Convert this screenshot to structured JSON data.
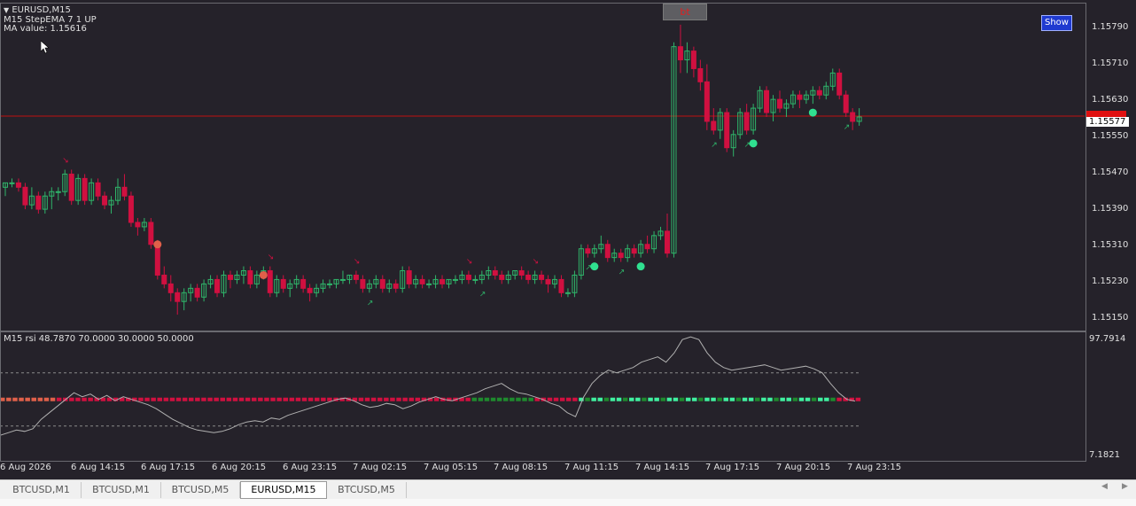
{
  "chart": {
    "symbol_header": "EURUSD,M15",
    "indicator_line": "M15 StepEMA 7 1 UP",
    "ma_value": "MA value: 1.15616",
    "show_button": "Show",
    "bt_button": "bt",
    "price_axis": [
      "1.15790",
      "1.15710",
      "1.15630",
      "1.15550",
      "1.15470",
      "1.15390",
      "1.15310",
      "1.15230",
      "1.15150"
    ],
    "current_price": "1.15577",
    "current_price_hidden": "1.15592",
    "time_axis": [
      "6 Aug 2026",
      "6 Aug 14:15",
      "6 Aug 17:15",
      "6 Aug 20:15",
      "6 Aug 23:15",
      "7 Aug 02:15",
      "7 Aug 05:15",
      "7 Aug 08:15",
      "7 Aug 11:15",
      "7 Aug 14:15",
      "7 Aug 17:15",
      "7 Aug 20:15",
      "7 Aug 23:15"
    ]
  },
  "rsi": {
    "label": "M15 rsi  48.7870 70.0000 30.0000 50.0000",
    "axis_top": "97.7914",
    "axis_bottom": "7.1821"
  },
  "tabs": [
    {
      "label": "BTCUSD,M1",
      "active": false
    },
    {
      "label": "BTCUSD,M1",
      "active": false
    },
    {
      "label": "BTCUSD,M5",
      "active": false
    },
    {
      "label": "EURUSD,M15",
      "active": true
    },
    {
      "label": "BTCUSD,M5",
      "active": false
    }
  ],
  "colors": {
    "background": "#25222a",
    "bull": "#2fb56a",
    "bear": "#d01040",
    "current_price_line": "#c01010",
    "rsi_line": "#b0b0b0"
  },
  "chart_data": {
    "type": "candlestick",
    "symbol": "EURUSD",
    "timeframe": "M15",
    "ylim": [
      1.1512,
      1.1583
    ],
    "candles": [
      [
        1.1543,
        1.1544,
        1.1541,
        1.1544
      ],
      [
        1.1544,
        1.1545,
        1.1543,
        1.1544
      ],
      [
        1.1544,
        1.1545,
        1.1542,
        1.1543
      ],
      [
        1.1543,
        1.1544,
        1.1538,
        1.1539
      ],
      [
        1.1539,
        1.1543,
        1.1538,
        1.1541
      ],
      [
        1.1541,
        1.1542,
        1.1537,
        1.1538
      ],
      [
        1.1538,
        1.1542,
        1.1537,
        1.1541
      ],
      [
        1.1541,
        1.1543,
        1.1538,
        1.1542
      ],
      [
        1.1542,
        1.1543,
        1.154,
        1.1542
      ],
      [
        1.1542,
        1.1547,
        1.1541,
        1.1546
      ],
      [
        1.1546,
        1.1547,
        1.1539,
        1.154
      ],
      [
        1.154,
        1.1546,
        1.1539,
        1.1545
      ],
      [
        1.1545,
        1.1546,
        1.1539,
        1.154
      ],
      [
        1.154,
        1.1545,
        1.1539,
        1.1544
      ],
      [
        1.1544,
        1.1545,
        1.154,
        1.1541
      ],
      [
        1.1541,
        1.1542,
        1.1538,
        1.1539
      ],
      [
        1.1539,
        1.1541,
        1.1537,
        1.154
      ],
      [
        1.154,
        1.1545,
        1.1539,
        1.1543
      ],
      [
        1.1543,
        1.1546,
        1.154,
        1.1541
      ],
      [
        1.1541,
        1.1542,
        1.1534,
        1.1535
      ],
      [
        1.1535,
        1.1536,
        1.1532,
        1.1534
      ],
      [
        1.1534,
        1.1536,
        1.1533,
        1.1535
      ],
      [
        1.1535,
        1.1536,
        1.1529,
        1.153
      ],
      [
        1.153,
        1.1531,
        1.1522,
        1.1523
      ],
      [
        1.1523,
        1.1525,
        1.152,
        1.1521
      ],
      [
        1.1521,
        1.1523,
        1.1517,
        1.1519
      ],
      [
        1.1519,
        1.152,
        1.1514,
        1.1517
      ],
      [
        1.1517,
        1.152,
        1.1515,
        1.1519
      ],
      [
        1.1519,
        1.1521,
        1.1517,
        1.152
      ],
      [
        1.152,
        1.1521,
        1.1517,
        1.1518
      ],
      [
        1.1518,
        1.1522,
        1.1517,
        1.1521
      ],
      [
        1.1521,
        1.1523,
        1.152,
        1.1522
      ],
      [
        1.1522,
        1.1523,
        1.1518,
        1.1519
      ],
      [
        1.1519,
        1.1524,
        1.1518,
        1.1523
      ],
      [
        1.1523,
        1.1524,
        1.152,
        1.1522
      ],
      [
        1.1522,
        1.1524,
        1.1521,
        1.1523
      ],
      [
        1.1523,
        1.1525,
        1.1521,
        1.1524
      ],
      [
        1.1524,
        1.1525,
        1.152,
        1.1521
      ],
      [
        1.1521,
        1.1524,
        1.152,
        1.1523
      ],
      [
        1.1523,
        1.1525,
        1.1522,
        1.1524
      ],
      [
        1.1524,
        1.1525,
        1.1518,
        1.1519
      ],
      [
        1.1519,
        1.1523,
        1.1518,
        1.1522
      ],
      [
        1.1522,
        1.1523,
        1.1519,
        1.152
      ],
      [
        1.152,
        1.1522,
        1.1518,
        1.1521
      ],
      [
        1.1521,
        1.1523,
        1.152,
        1.1522
      ],
      [
        1.1522,
        1.1523,
        1.1519,
        1.152
      ],
      [
        1.152,
        1.1521,
        1.1517,
        1.1519
      ],
      [
        1.1519,
        1.1521,
        1.1518,
        1.152
      ],
      [
        1.152,
        1.1522,
        1.1519,
        1.1521
      ],
      [
        1.1521,
        1.1522,
        1.152,
        1.1521
      ],
      [
        1.1521,
        1.1522,
        1.152,
        1.1522
      ],
      [
        1.1522,
        1.1524,
        1.1521,
        1.1522
      ],
      [
        1.1522,
        1.1523,
        1.1521,
        1.1523
      ],
      [
        1.1523,
        1.1524,
        1.1521,
        1.1522
      ],
      [
        1.1522,
        1.1523,
        1.1519,
        1.152
      ],
      [
        1.152,
        1.1522,
        1.1519,
        1.1521
      ],
      [
        1.1521,
        1.1523,
        1.152,
        1.1522
      ],
      [
        1.1522,
        1.1523,
        1.1519,
        1.152
      ],
      [
        1.152,
        1.1522,
        1.1519,
        1.1521
      ],
      [
        1.1521,
        1.1522,
        1.1519,
        1.152
      ],
      [
        1.152,
        1.1525,
        1.1519,
        1.1524
      ],
      [
        1.1524,
        1.1525,
        1.152,
        1.1521
      ],
      [
        1.1521,
        1.1523,
        1.152,
        1.1522
      ],
      [
        1.1522,
        1.1523,
        1.152,
        1.1521
      ],
      [
        1.1521,
        1.1522,
        1.152,
        1.1521
      ],
      [
        1.1521,
        1.1523,
        1.152,
        1.1522
      ],
      [
        1.1522,
        1.1523,
        1.152,
        1.1521
      ],
      [
        1.1521,
        1.1522,
        1.152,
        1.1522
      ],
      [
        1.1522,
        1.1523,
        1.1521,
        1.1522
      ],
      [
        1.1522,
        1.1524,
        1.1521,
        1.1523
      ],
      [
        1.1523,
        1.1524,
        1.1521,
        1.1522
      ],
      [
        1.1522,
        1.1523,
        1.1521,
        1.1522
      ],
      [
        1.1522,
        1.1524,
        1.1521,
        1.1523
      ],
      [
        1.1523,
        1.1525,
        1.1522,
        1.1524
      ],
      [
        1.1524,
        1.1525,
        1.1522,
        1.1523
      ],
      [
        1.1523,
        1.1524,
        1.1521,
        1.1522
      ],
      [
        1.1522,
        1.1524,
        1.1521,
        1.1523
      ],
      [
        1.1523,
        1.1524,
        1.1522,
        1.1524
      ],
      [
        1.1524,
        1.1525,
        1.1522,
        1.1523
      ],
      [
        1.1523,
        1.1524,
        1.1521,
        1.1522
      ],
      [
        1.1522,
        1.1524,
        1.1521,
        1.1523
      ],
      [
        1.1523,
        1.1524,
        1.1521,
        1.1522
      ],
      [
        1.1522,
        1.1523,
        1.1519,
        1.1521
      ],
      [
        1.1521,
        1.1523,
        1.152,
        1.1522
      ],
      [
        1.1522,
        1.1523,
        1.1518,
        1.1519
      ],
      [
        1.1519,
        1.152,
        1.1518,
        1.1519
      ],
      [
        1.1519,
        1.1524,
        1.1518,
        1.1523
      ],
      [
        1.1523,
        1.153,
        1.1522,
        1.1529
      ],
      [
        1.1529,
        1.153,
        1.1527,
        1.1528
      ],
      [
        1.1528,
        1.153,
        1.1527,
        1.1529
      ],
      [
        1.1529,
        1.1532,
        1.1528,
        1.153
      ],
      [
        1.153,
        1.1531,
        1.1526,
        1.1527
      ],
      [
        1.1527,
        1.1529,
        1.1526,
        1.1528
      ],
      [
        1.1528,
        1.1529,
        1.1526,
        1.1527
      ],
      [
        1.1527,
        1.153,
        1.1526,
        1.1529
      ],
      [
        1.1529,
        1.153,
        1.1527,
        1.1528
      ],
      [
        1.1528,
        1.1531,
        1.1527,
        1.153
      ],
      [
        1.153,
        1.1532,
        1.1528,
        1.1529
      ],
      [
        1.1529,
        1.1533,
        1.1528,
        1.1532
      ],
      [
        1.1532,
        1.1534,
        1.1531,
        1.1533
      ],
      [
        1.1533,
        1.1537,
        1.1527,
        1.1528
      ],
      [
        1.1528,
        1.1576,
        1.1527,
        1.1575
      ],
      [
        1.1575,
        1.158,
        1.1569,
        1.1572
      ],
      [
        1.1572,
        1.1576,
        1.1569,
        1.1574
      ],
      [
        1.1574,
        1.1575,
        1.1568,
        1.157
      ],
      [
        1.157,
        1.1572,
        1.1565,
        1.1567
      ],
      [
        1.1567,
        1.1571,
        1.1556,
        1.1558
      ],
      [
        1.1558,
        1.1561,
        1.1555,
        1.1556
      ],
      [
        1.1556,
        1.1561,
        1.1554,
        1.156
      ],
      [
        1.156,
        1.1561,
        1.1551,
        1.1552
      ],
      [
        1.1552,
        1.1556,
        1.155,
        1.1555
      ],
      [
        1.1555,
        1.1561,
        1.1554,
        1.156
      ],
      [
        1.156,
        1.1562,
        1.1555,
        1.1556
      ],
      [
        1.1556,
        1.1562,
        1.1555,
        1.1561
      ],
      [
        1.1561,
        1.1566,
        1.156,
        1.1565
      ],
      [
        1.1565,
        1.1566,
        1.1559,
        1.156
      ],
      [
        1.156,
        1.1564,
        1.1558,
        1.1563
      ],
      [
        1.1563,
        1.1565,
        1.156,
        1.1561
      ],
      [
        1.1561,
        1.1563,
        1.1559,
        1.1562
      ],
      [
        1.1562,
        1.1565,
        1.1561,
        1.1564
      ],
      [
        1.1564,
        1.1565,
        1.1561,
        1.1563
      ],
      [
        1.1563,
        1.1565,
        1.1562,
        1.1564
      ],
      [
        1.1564,
        1.1566,
        1.1562,
        1.1565
      ],
      [
        1.1565,
        1.1566,
        1.1563,
        1.1564
      ],
      [
        1.1564,
        1.1567,
        1.1563,
        1.1566
      ],
      [
        1.1566,
        1.157,
        1.1565,
        1.1569
      ],
      [
        1.1569,
        1.157,
        1.1563,
        1.1564
      ],
      [
        1.1564,
        1.1565,
        1.1559,
        1.156
      ],
      [
        1.156,
        1.1561,
        1.1556,
        1.1558
      ],
      [
        1.1558,
        1.1561,
        1.1557,
        1.1559
      ]
    ],
    "rsi_ylim": [
      7.1821,
      97.7914
    ],
    "rsi_levels": [
      70,
      50,
      30
    ],
    "rsi_values": [
      23,
      25,
      27,
      26,
      28,
      35,
      40,
      45,
      50,
      55,
      52,
      54,
      50,
      53,
      49,
      52,
      50,
      48,
      46,
      43,
      39,
      35,
      32,
      29,
      27,
      26,
      25,
      26,
      28,
      31,
      33,
      34,
      33,
      36,
      35,
      38,
      40,
      42,
      44,
      46,
      48,
      50,
      51,
      49,
      46,
      44,
      45,
      47,
      46,
      43,
      45,
      48,
      50,
      52,
      50,
      49,
      51,
      53,
      55,
      58,
      60,
      62,
      58,
      55,
      54,
      52,
      50,
      47,
      45,
      40,
      37,
      52,
      62,
      68,
      72,
      70,
      72,
      74,
      78,
      80,
      82,
      78,
      85,
      95,
      97,
      95,
      85,
      78,
      74,
      72,
      73,
      74,
      75,
      76,
      74,
      72,
      73,
      74,
      75,
      73,
      70,
      62,
      55,
      50,
      48.787
    ]
  }
}
